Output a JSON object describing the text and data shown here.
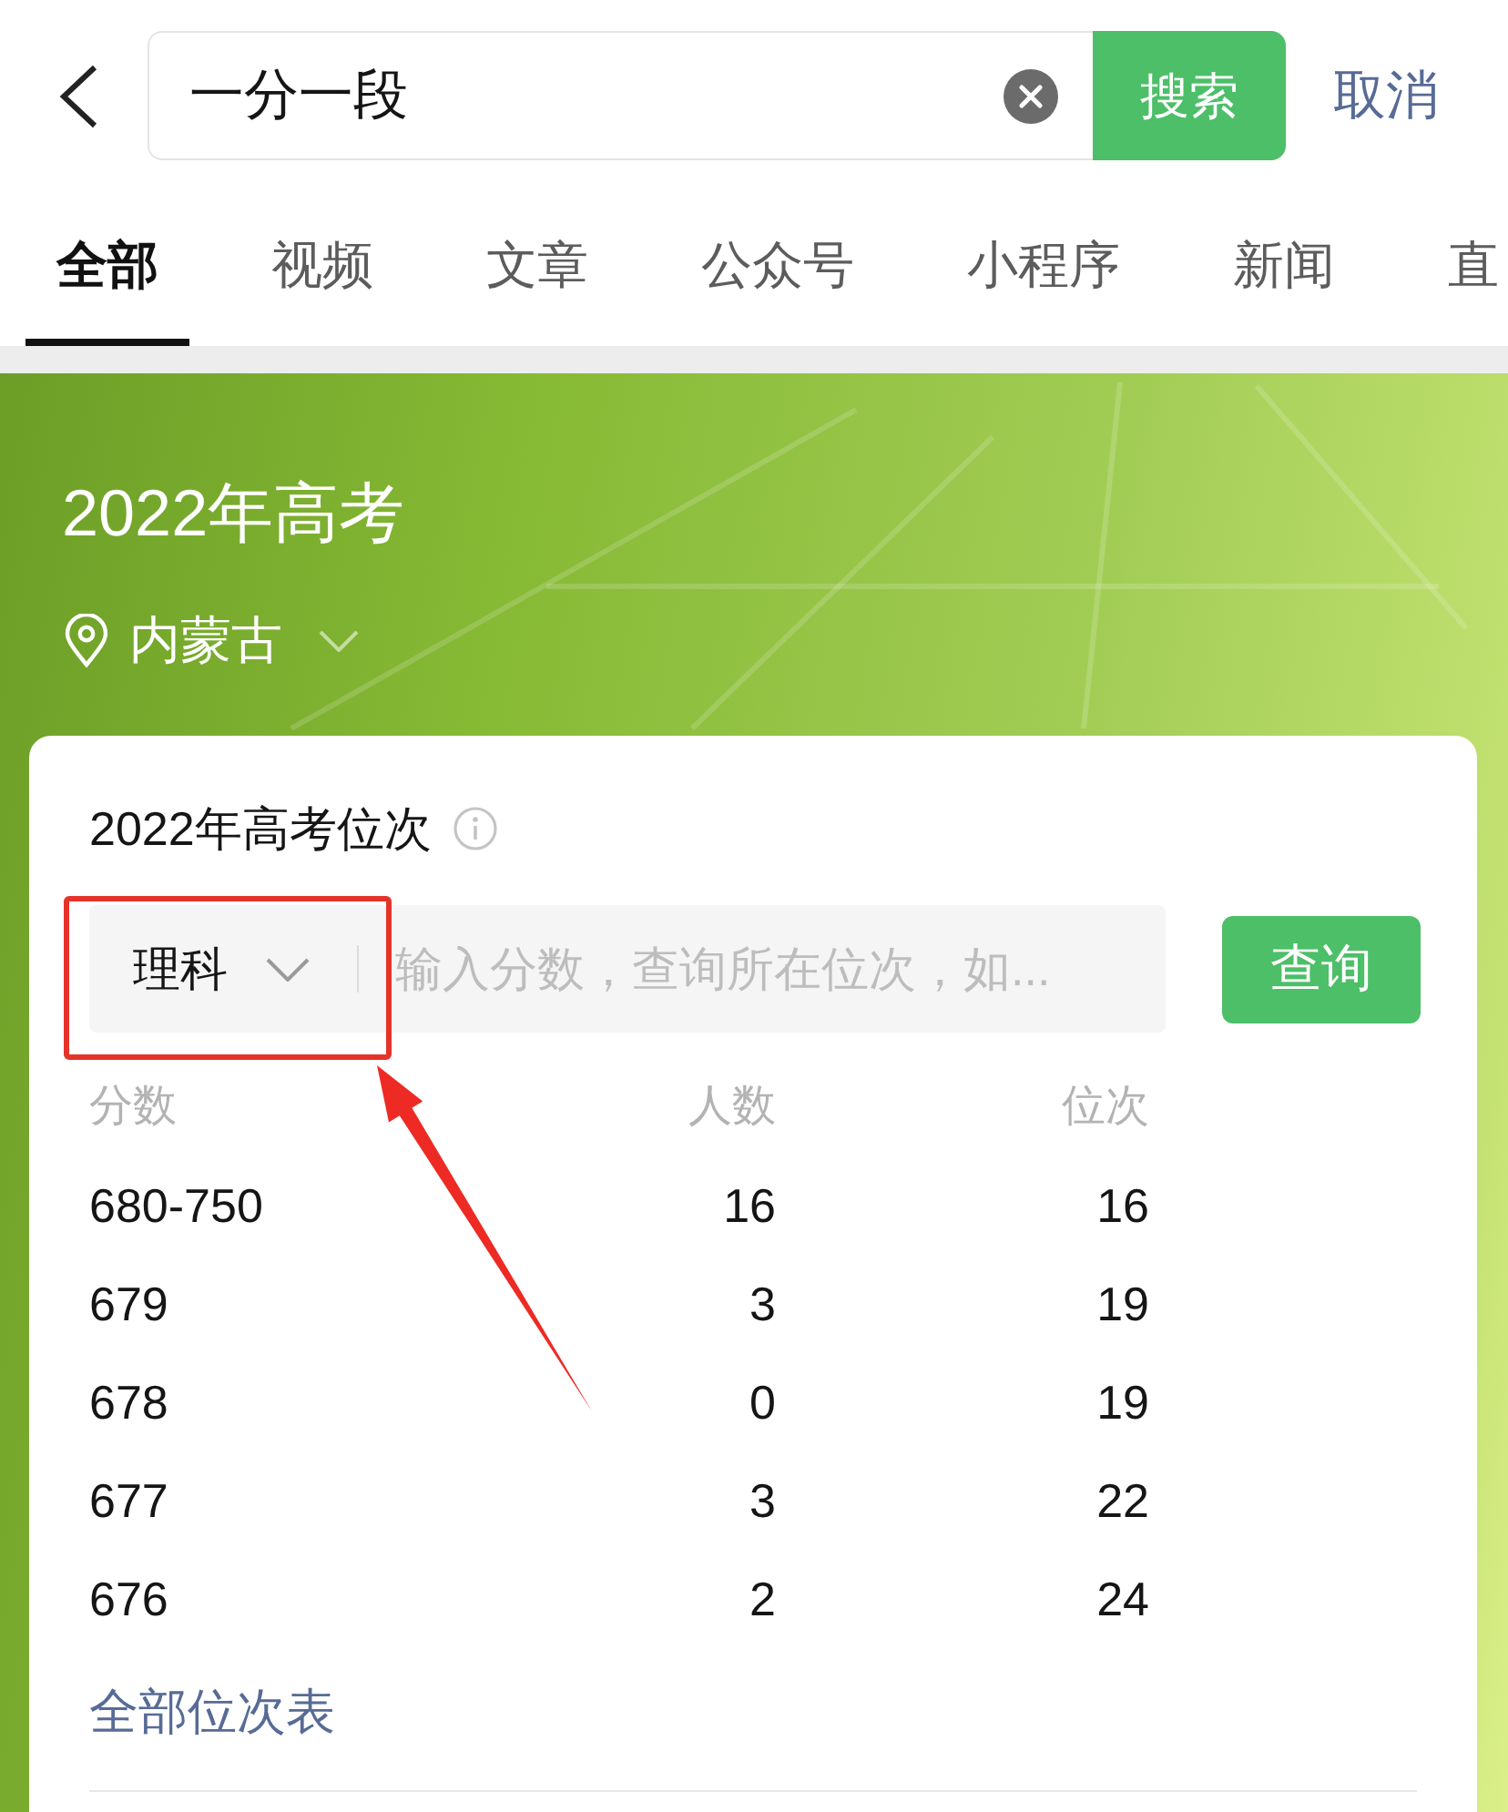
{
  "search_bar": {
    "value": "一分一段",
    "search_button": "搜索",
    "cancel_button": "取消"
  },
  "tabs": [
    {
      "label": "全部",
      "selected": true
    },
    {
      "label": "视频",
      "selected": false
    },
    {
      "label": "文章",
      "selected": false
    },
    {
      "label": "公众号",
      "selected": false
    },
    {
      "label": "小程序",
      "selected": false
    },
    {
      "label": "新闻",
      "selected": false
    },
    {
      "label": "直",
      "selected": false
    }
  ],
  "banner": {
    "title": "2022年高考",
    "location": "内蒙古"
  },
  "ranking_card": {
    "title": "2022年高考位次",
    "subject": "理科",
    "score_field": {
      "placeholder": "输入分数，查询所在位次，如..."
    },
    "query_button": "查询",
    "columns": [
      "分数",
      "人数",
      "位次"
    ],
    "rows": [
      [
        "680-750",
        "16",
        "16"
      ],
      [
        "679",
        "3",
        "19"
      ],
      [
        "678",
        "0",
        "19"
      ],
      [
        "677",
        "3",
        "22"
      ],
      [
        "676",
        "2",
        "24"
      ]
    ],
    "all_link": "全部位次表"
  }
}
